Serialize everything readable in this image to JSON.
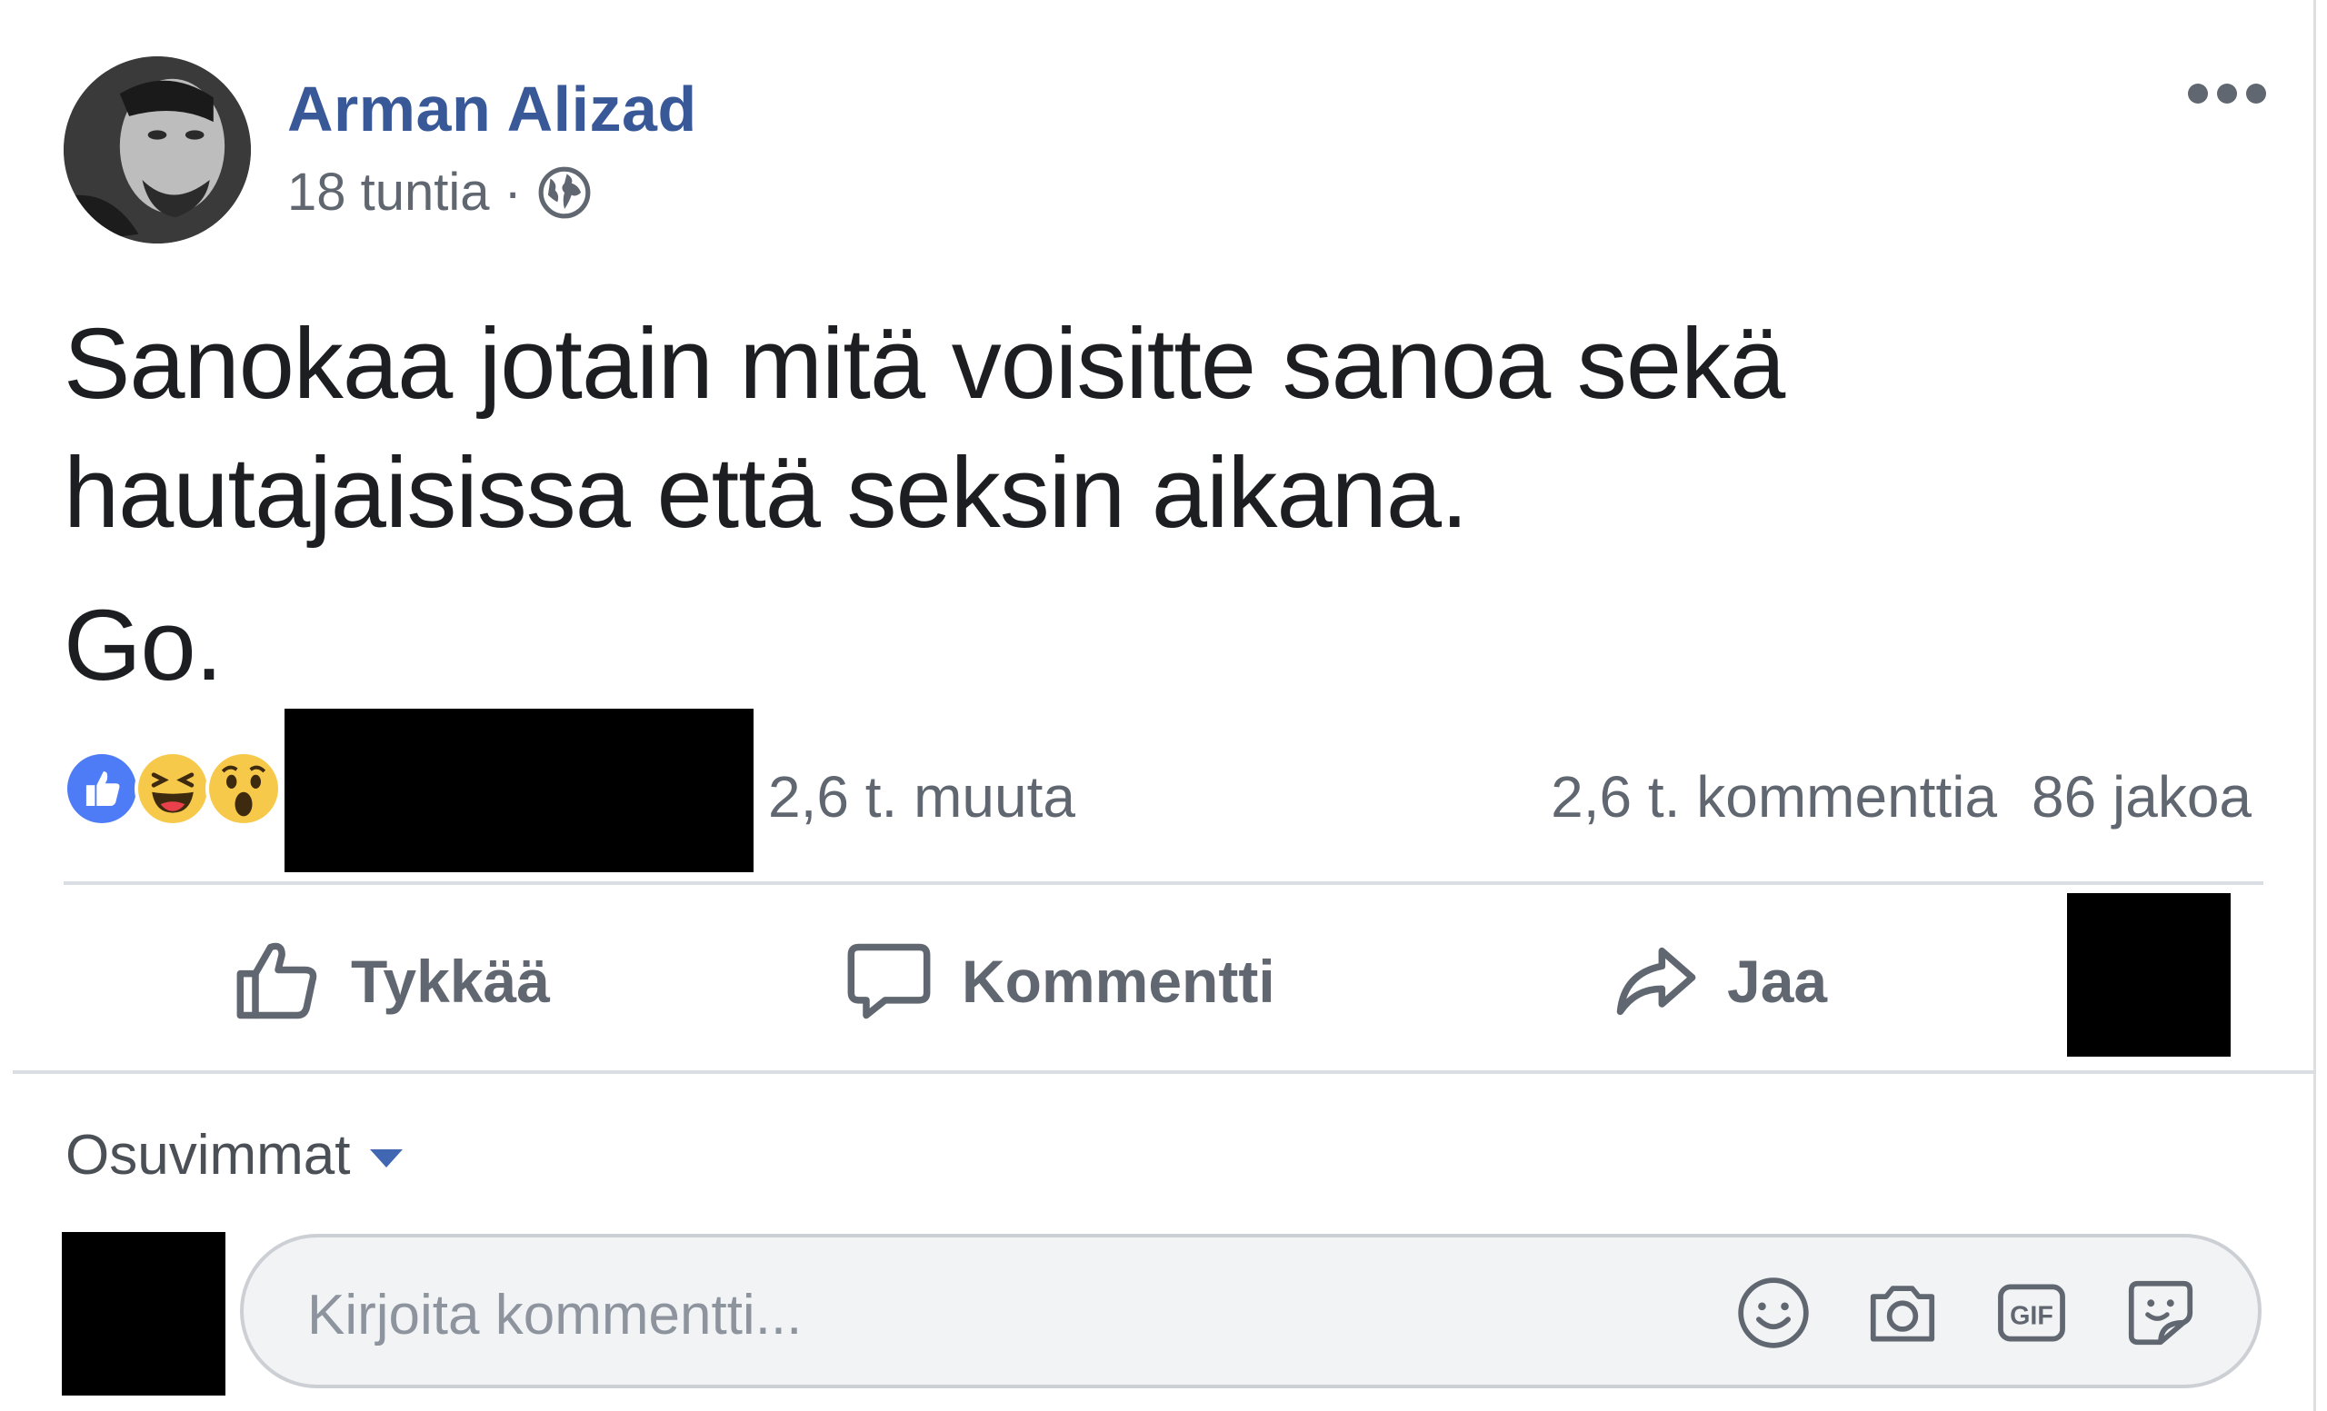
{
  "post": {
    "author": "Arman Alizad",
    "time": "18 tuntia",
    "separator": "·",
    "audience_icon": "globe-icon",
    "text_line1": "Sanokaa jotain mitä voisitte sanoa sekä hautajaisissa että seksin aikana.",
    "text_line2": "Go."
  },
  "reactions": {
    "icons": [
      "like-reaction-icon",
      "haha-reaction-icon",
      "wow-reaction-icon"
    ],
    "others": "2,6 t. muuta",
    "comments": "2,6 t. kommenttia",
    "shares": "86 jakoa"
  },
  "actions": {
    "like": "Tykkää",
    "comment": "Kommentti",
    "share": "Jaa"
  },
  "comments": {
    "sort_label": "Osuvimmat",
    "input_placeholder": "Kirjoita kommentti...",
    "tools": [
      "emoji-icon",
      "camera-icon",
      "gif-icon",
      "sticker-icon"
    ],
    "gif_label": "GIF"
  },
  "colors": {
    "author": "#385898",
    "secondary_text": "#606770",
    "like_blue": "#4267b2",
    "emoji_yellow": "#f7c94b"
  }
}
